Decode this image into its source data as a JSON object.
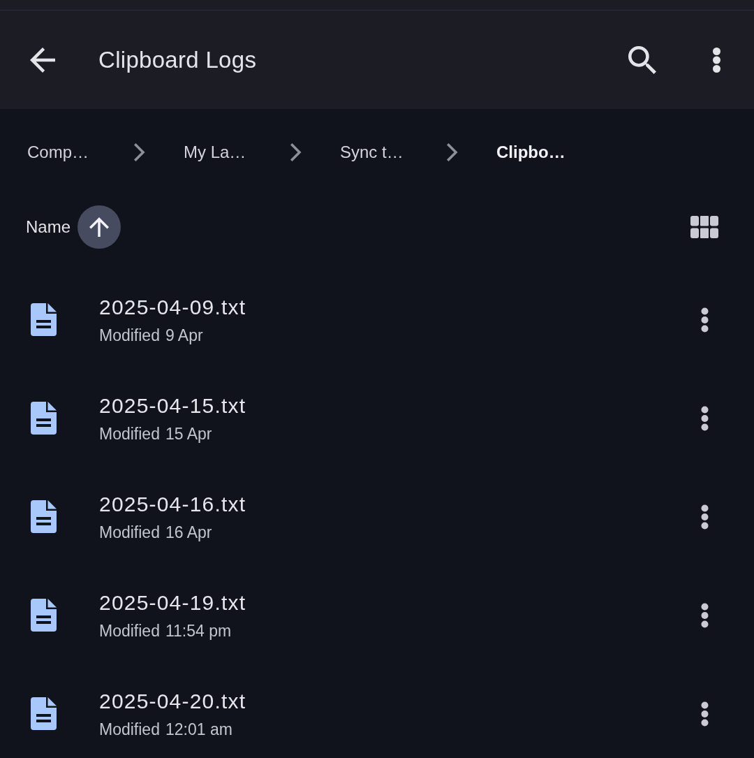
{
  "app_bar": {
    "title": "Clipboard Logs"
  },
  "breadcrumbs": [
    {
      "label": "Comp…",
      "selected": false
    },
    {
      "label": "My La…",
      "selected": false
    },
    {
      "label": "Sync t…",
      "selected": false
    },
    {
      "label": "Clipbo…",
      "selected": true
    }
  ],
  "sort": {
    "label": "Name",
    "ascending": true
  },
  "files": [
    {
      "name": "2025-04-09.txt",
      "modified_label": "Modified",
      "modified": "9 Apr"
    },
    {
      "name": "2025-04-15.txt",
      "modified_label": "Modified",
      "modified": "15 Apr"
    },
    {
      "name": "2025-04-16.txt",
      "modified_label": "Modified",
      "modified": "16 Apr"
    },
    {
      "name": "2025-04-19.txt",
      "modified_label": "Modified",
      "modified": "11:54 pm"
    },
    {
      "name": "2025-04-20.txt",
      "modified_label": "Modified",
      "modified": "12:01 am"
    }
  ]
}
